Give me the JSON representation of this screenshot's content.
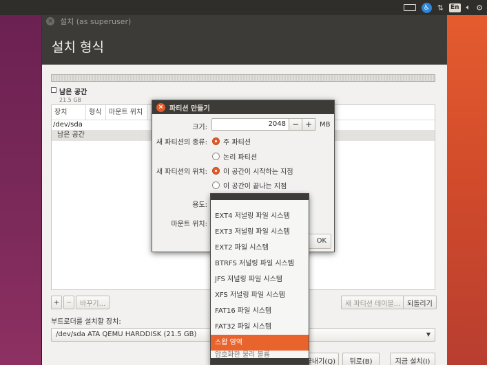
{
  "top_panel": {
    "icons": [
      "keyboard-icon",
      "accessibility-icon",
      "network-icon",
      "lang-indicator",
      "volume-icon",
      "power-gear-icon"
    ],
    "lang": "En"
  },
  "window": {
    "title": "설치 (as superuser)",
    "header": "설치 형식"
  },
  "partition_map": {
    "legend_title": "남은 공간",
    "legend_size": "21.5 GB"
  },
  "table": {
    "columns": [
      "장치",
      "형식",
      "마운트 위치",
      "포"
    ],
    "rows": [
      {
        "label": "/dev/sda",
        "selected": false
      },
      {
        "label": "남은 공간",
        "selected": true
      }
    ]
  },
  "table_buttons": {
    "add": "+",
    "remove": "−",
    "change": "바꾸기...",
    "new_table": "새 파티션 테이블...",
    "revert": "되돌리기"
  },
  "bootloader": {
    "label": "부트로더를 설치할 장치:",
    "value": "/dev/sda ATA QEMU HARDDISK (21.5 GB)"
  },
  "bottom_buttons": {
    "quit": "끝내기(Q)",
    "back": "뒤로(B)",
    "install": "지금 설치(I)"
  },
  "dialog": {
    "title": "파티션 만들기",
    "size_label": "크기:",
    "size_value": "2048",
    "minus": "−",
    "plus": "+",
    "unit": "MB",
    "type_label": "새 파티션의 종류:",
    "type_primary": "주 파티션",
    "type_logical": "논리 파티션",
    "location_label": "새 파티션의 위치:",
    "location_start": "이 공간이 시작하는 지점",
    "location_end": "이 공간이 끝나는 지점",
    "use_label": "용도:",
    "mount_label": "마운트 위치:",
    "ok": "OK"
  },
  "menu": {
    "items": [
      {
        "label": "EXT4 저널링 파일 시스템",
        "selected": false
      },
      {
        "label": "EXT3 저널링 파일 시스템",
        "selected": false
      },
      {
        "label": "EXT2 파일 시스템",
        "selected": false
      },
      {
        "label": "BTRFS 저널링 파일 시스템",
        "selected": false
      },
      {
        "label": "JFS 저널링 파일 시스템",
        "selected": false
      },
      {
        "label": "XFS 저널링 파일 시스템",
        "selected": false
      },
      {
        "label": "FAT16 파일 시스템",
        "selected": false
      },
      {
        "label": "FAT32 파일 시스템",
        "selected": false
      },
      {
        "label": "스왑 영역",
        "selected": true
      }
    ],
    "partial_item": "암호화한 물리 볼륨"
  }
}
